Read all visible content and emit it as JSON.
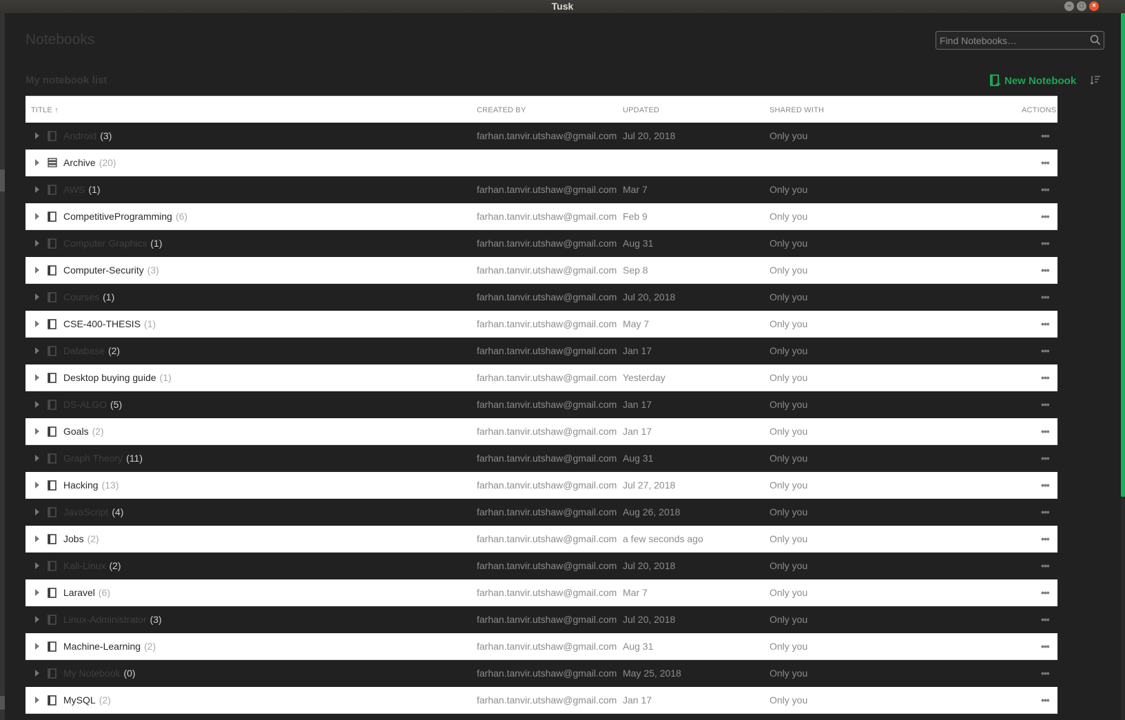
{
  "window": {
    "title": "Tusk"
  },
  "header": {
    "title": "Notebooks",
    "search_placeholder": "Find Notebooks…"
  },
  "list": {
    "title": "My notebook list",
    "new_button": "New Notebook",
    "columns": {
      "title": "TITLE",
      "created_by": "CREATED BY",
      "updated": "UPDATED",
      "shared_with": "SHARED WITH",
      "actions": "ACTIONS"
    },
    "rows": [
      {
        "name": "Android",
        "count": "(3)",
        "created_by": "farhan.tanvir.utshaw@gmail.com",
        "updated": "Jul 20, 2018",
        "shared": "Only you",
        "icon": "notebook-icon"
      },
      {
        "name": "Archive",
        "count": "(20)",
        "created_by": "",
        "updated": "",
        "shared": "",
        "icon": "stack-icon"
      },
      {
        "name": "AWS",
        "count": "(1)",
        "created_by": "farhan.tanvir.utshaw@gmail.com",
        "updated": "Mar 7",
        "shared": "Only you",
        "icon": "notebook-icon"
      },
      {
        "name": "CompetitiveProgramming",
        "count": "(6)",
        "created_by": "farhan.tanvir.utshaw@gmail.com",
        "updated": "Feb 9",
        "shared": "Only you",
        "icon": "notebook-icon"
      },
      {
        "name": "Computer Graphics",
        "count": "(1)",
        "created_by": "farhan.tanvir.utshaw@gmail.com",
        "updated": "Aug 31",
        "shared": "Only you",
        "icon": "notebook-icon"
      },
      {
        "name": "Computer-Security",
        "count": "(3)",
        "created_by": "farhan.tanvir.utshaw@gmail.com",
        "updated": "Sep 8",
        "shared": "Only you",
        "icon": "notebook-icon"
      },
      {
        "name": "Courses",
        "count": "(1)",
        "created_by": "farhan.tanvir.utshaw@gmail.com",
        "updated": "Jul 20, 2018",
        "shared": "Only you",
        "icon": "notebook-icon"
      },
      {
        "name": "CSE-400-THESIS",
        "count": "(1)",
        "created_by": "farhan.tanvir.utshaw@gmail.com",
        "updated": "May 7",
        "shared": "Only you",
        "icon": "notebook-icon"
      },
      {
        "name": "Database",
        "count": "(2)",
        "created_by": "farhan.tanvir.utshaw@gmail.com",
        "updated": "Jan 17",
        "shared": "Only you",
        "icon": "notebook-icon"
      },
      {
        "name": "Desktop buying guide",
        "count": "(1)",
        "created_by": "farhan.tanvir.utshaw@gmail.com",
        "updated": "Yesterday",
        "shared": "Only you",
        "icon": "notebook-icon"
      },
      {
        "name": "DS-ALGO",
        "count": "(5)",
        "created_by": "farhan.tanvir.utshaw@gmail.com",
        "updated": "Jan 17",
        "shared": "Only you",
        "icon": "notebook-icon"
      },
      {
        "name": "Goals",
        "count": "(2)",
        "created_by": "farhan.tanvir.utshaw@gmail.com",
        "updated": "Jan 17",
        "shared": "Only you",
        "icon": "notebook-icon"
      },
      {
        "name": "Graph Theory",
        "count": "(11)",
        "created_by": "farhan.tanvir.utshaw@gmail.com",
        "updated": "Aug 31",
        "shared": "Only you",
        "icon": "notebook-icon"
      },
      {
        "name": "Hacking",
        "count": "(13)",
        "created_by": "farhan.tanvir.utshaw@gmail.com",
        "updated": "Jul 27, 2018",
        "shared": "Only you",
        "icon": "notebook-icon"
      },
      {
        "name": "JavaScript",
        "count": "(4)",
        "created_by": "farhan.tanvir.utshaw@gmail.com",
        "updated": "Aug 26, 2018",
        "shared": "Only you",
        "icon": "notebook-icon"
      },
      {
        "name": "Jobs",
        "count": "(2)",
        "created_by": "farhan.tanvir.utshaw@gmail.com",
        "updated": "a few seconds ago",
        "shared": "Only you",
        "icon": "notebook-icon"
      },
      {
        "name": "Kali-Linux",
        "count": "(2)",
        "created_by": "farhan.tanvir.utshaw@gmail.com",
        "updated": "Jul 20, 2018",
        "shared": "Only you",
        "icon": "notebook-icon"
      },
      {
        "name": "Laravel",
        "count": "(6)",
        "created_by": "farhan.tanvir.utshaw@gmail.com",
        "updated": "Mar 7",
        "shared": "Only you",
        "icon": "notebook-icon"
      },
      {
        "name": "Linux-Administrator",
        "count": "(3)",
        "created_by": "farhan.tanvir.utshaw@gmail.com",
        "updated": "Jul 20, 2018",
        "shared": "Only you",
        "icon": "notebook-icon"
      },
      {
        "name": "Machine-Learning",
        "count": "(2)",
        "created_by": "farhan.tanvir.utshaw@gmail.com",
        "updated": "Aug 31",
        "shared": "Only you",
        "icon": "notebook-icon"
      },
      {
        "name": "My Notebook",
        "count": "(0)",
        "created_by": "farhan.tanvir.utshaw@gmail.com",
        "updated": "May 25, 2018",
        "shared": "Only you",
        "icon": "notebook-icon"
      },
      {
        "name": "MySQL",
        "count": "(2)",
        "created_by": "farhan.tanvir.utshaw@gmail.com",
        "updated": "Jan 17",
        "shared": "Only you",
        "icon": "notebook-icon"
      }
    ]
  },
  "colors": {
    "accent": "#1ca652",
    "dark_row": "#212121",
    "light_row": "#ffffff"
  }
}
